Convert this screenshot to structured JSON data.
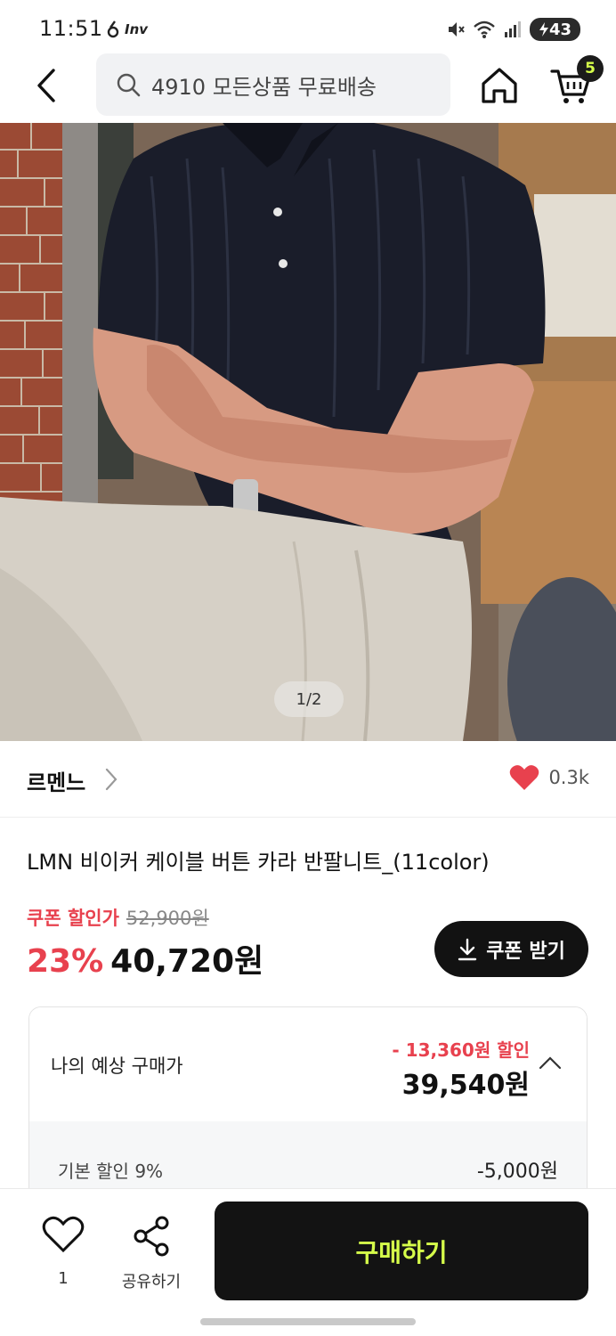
{
  "status_bar": {
    "time": "11:51",
    "app_indicator": "Inv",
    "battery": "43"
  },
  "nav": {
    "search_text": "4910 모든상품 무료배송",
    "cart_badge": "5"
  },
  "product_image": {
    "counter": "1/2"
  },
  "brand": {
    "name": "르멘느",
    "like_count": "0.3k"
  },
  "product": {
    "title": "LMN 비이커 케이블 버튼 카라 반팔니트_(11color)"
  },
  "price": {
    "coupon_label": "쿠폰 할인가",
    "original_price": "52,900원",
    "discount_rate": "23%",
    "final_price": "40,720원",
    "coupon_button_label": "쿠폰 받기"
  },
  "expected": {
    "label": "나의 예상 구매가",
    "discount": "- 13,360원 할인",
    "price": "39,540원",
    "detail_label": "기본 할인 9%",
    "detail_value": "-5,000원"
  },
  "bottom": {
    "wish_count": "1",
    "share_label": "공유하기",
    "buy_label": "구매하기"
  },
  "colors": {
    "accent_red": "#e8414e",
    "accent_lime": "#d6ff4a",
    "dark": "#131313"
  }
}
